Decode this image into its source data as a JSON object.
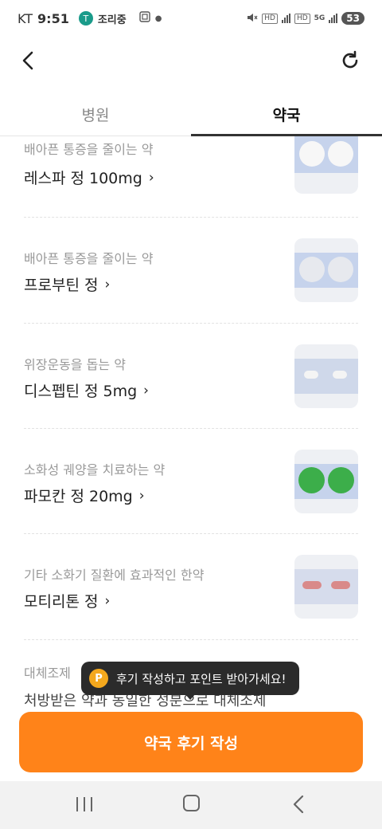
{
  "status_bar": {
    "carrier": "KT",
    "time": "9:51",
    "app_badge": "T",
    "app_label": "조리중",
    "hd1": "HD",
    "hd2": "HD",
    "net": "5G",
    "battery": "53"
  },
  "tabs": [
    {
      "label": "병원",
      "active": false
    },
    {
      "label": "약국",
      "active": true
    }
  ],
  "items": [
    {
      "desc": "배아픈 통증을 줄이는 약",
      "name": "레스파 정 100mg",
      "chevron": "›"
    },
    {
      "desc": "배아픈 통증을 줄이는 약",
      "name": "프로부틴 정",
      "chevron": "›"
    },
    {
      "desc": "위장운동을 돕는 약",
      "name": "디스펩틴 정 5mg",
      "chevron": "›"
    },
    {
      "desc": "소화성 궤양을 치료하는 약",
      "name": "파모칸 정 20mg",
      "chevron": "›"
    },
    {
      "desc": "기타 소화기 질환에 효과적인 한약",
      "name": "모티리톤 정",
      "chevron": "›"
    }
  ],
  "partial_section": {
    "desc": "대체조제",
    "text": "처방받은 약과 동일한 성분으로 대체조제"
  },
  "tooltip": {
    "icon": "P",
    "text": "후기 작성하고 포인트 받아가세요!"
  },
  "cta": {
    "label": "약국 후기 작성"
  },
  "colors": {
    "accent": "#ff8319",
    "tooltip_bg": "#2b2b2b",
    "point_icon": "#f4a81d"
  },
  "icons": {
    "back": "chevron-left-icon",
    "refresh": "refresh-icon",
    "nav_recent": "recent-apps-icon",
    "nav_home": "home-icon",
    "nav_back": "back-icon"
  }
}
